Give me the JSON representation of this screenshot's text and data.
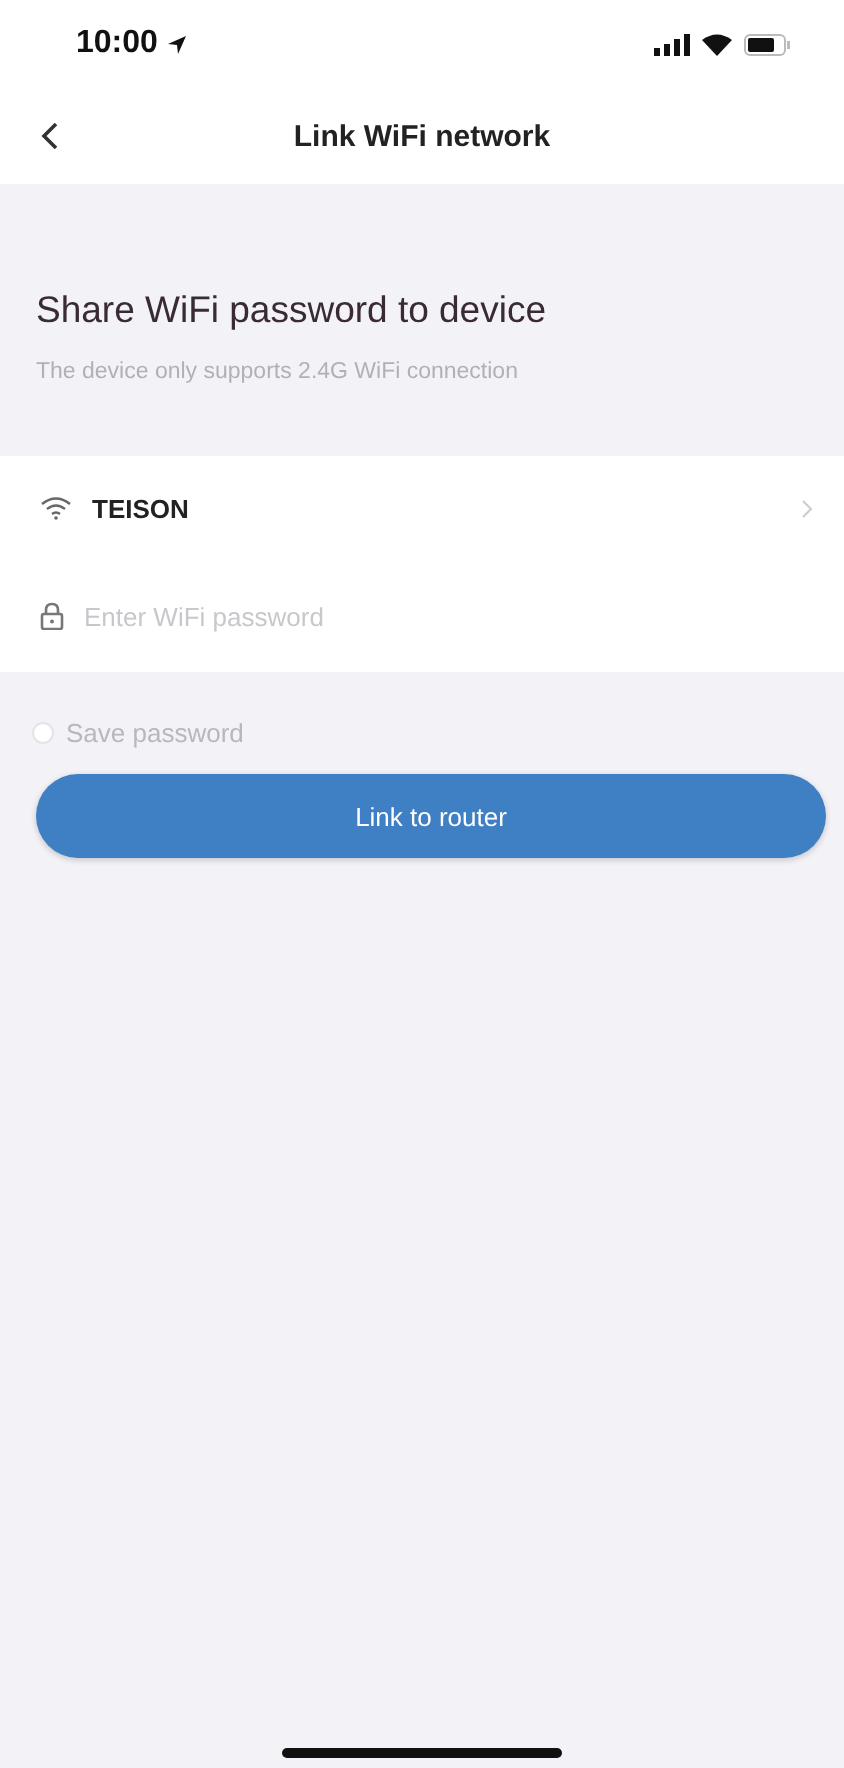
{
  "status_bar": {
    "time": "10:00"
  },
  "nav": {
    "title": "Link WiFi network"
  },
  "header": {
    "title": "Share WiFi password to device",
    "subtitle": "The device only supports 2.4G WiFi connection"
  },
  "network": {
    "name": "TEISON"
  },
  "password": {
    "placeholder": "Enter WiFi password"
  },
  "save_password": {
    "label": "Save password",
    "checked": false
  },
  "button": {
    "label": "Link to router"
  }
}
